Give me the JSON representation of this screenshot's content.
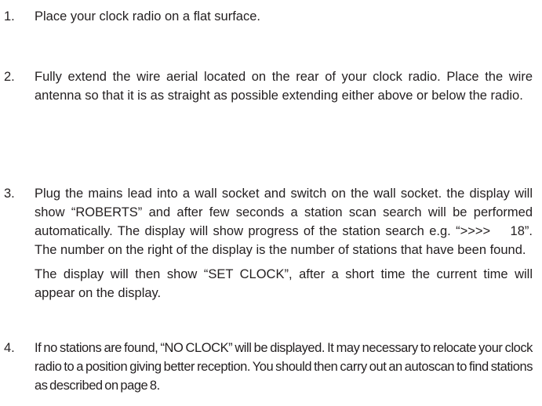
{
  "instructions": [
    {
      "number": "1.",
      "paragraphs": [
        "Place your clock radio on a flat surface."
      ]
    },
    {
      "number": "2.",
      "paragraphs": [
        "Fully extend the wire aerial located on the rear of your clock radio. Place the wire antenna so that it is as straight as possible extending either above or below the radio."
      ]
    },
    {
      "number": "3.",
      "paragraphs": [
        "Plug the mains lead into a wall socket and switch on the wall socket. the display will show “ROBERTS” and after few seconds a station scan search will be performed automatically. The display will show progress of the station search e.g. “>>>>    18”. The number on the right of the display is the number of stations that have been found.",
        "The display will then show “SET CLOCK”, after a short time the current time will appear on the display."
      ]
    },
    {
      "number": "4.",
      "paragraphs": [
        "If no stations are found, “NO CLOCK” will be displayed. It may necessary to relocate your clock radio to a position giving better reception. You should then carry out an autoscan to find stations as described on page 8."
      ]
    }
  ]
}
